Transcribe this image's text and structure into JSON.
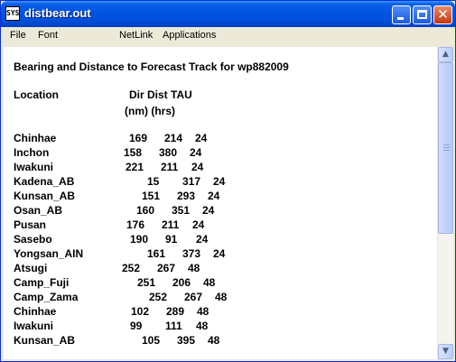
{
  "window": {
    "title": "distbear.out",
    "app_icon_text": "SYS"
  },
  "menu": [
    "File",
    "Font",
    "NetLink",
    "Applications"
  ],
  "report": {
    "title": "Bearing and Distance to Forecast Track for wp882009",
    "headers": {
      "location": "Location",
      "dir_dist_tau": "Dir  Dist  TAU",
      "units": "(nm) (hrs)"
    },
    "rows": [
      {
        "loc": "Chinhae",
        "dir": "169",
        "dist": "214",
        "tau": "24"
      },
      {
        "loc": "Inchon",
        "dir": "158",
        "dist": "380",
        "tau": "24"
      },
      {
        "loc": "Iwakuni",
        "dir": "221",
        "dist": "211",
        "tau": "24"
      },
      {
        "loc": "Kadena_AB",
        "dir": "15",
        "dist": "317",
        "tau": "24"
      },
      {
        "loc": "Kunsan_AB",
        "dir": "151",
        "dist": "293",
        "tau": "24"
      },
      {
        "loc": "Osan_AB",
        "dir": "160",
        "dist": "351",
        "tau": "24"
      },
      {
        "loc": "Pusan",
        "dir": "176",
        "dist": "211",
        "tau": "24"
      },
      {
        "loc": "Sasebo",
        "dir": "190",
        "dist": "91",
        "tau": "24"
      },
      {
        "loc": "Yongsan_AIN",
        "dir": "161",
        "dist": "373",
        "tau": "24"
      },
      {
        "loc": "Atsugi",
        "dir": "252",
        "dist": "267",
        "tau": "48"
      },
      {
        "loc": "Camp_Fuji",
        "dir": "251",
        "dist": "206",
        "tau": "48"
      },
      {
        "loc": "Camp_Zama",
        "dir": "252",
        "dist": "267",
        "tau": "48"
      },
      {
        "loc": "Chinhae",
        "dir": "102",
        "dist": "289",
        "tau": "48"
      },
      {
        "loc": "Iwakuni",
        "dir": "99",
        "dist": "111",
        "tau": "48"
      },
      {
        "loc": "Kunsan_AB",
        "dir": "105",
        "dist": "395",
        "tau": "48"
      }
    ]
  },
  "icons": {
    "minimize": "minimize-icon",
    "maximize": "maximize-icon",
    "close": "close-icon",
    "scroll_up": "scroll-up-arrow-icon",
    "scroll_down": "scroll-down-arrow-icon"
  }
}
